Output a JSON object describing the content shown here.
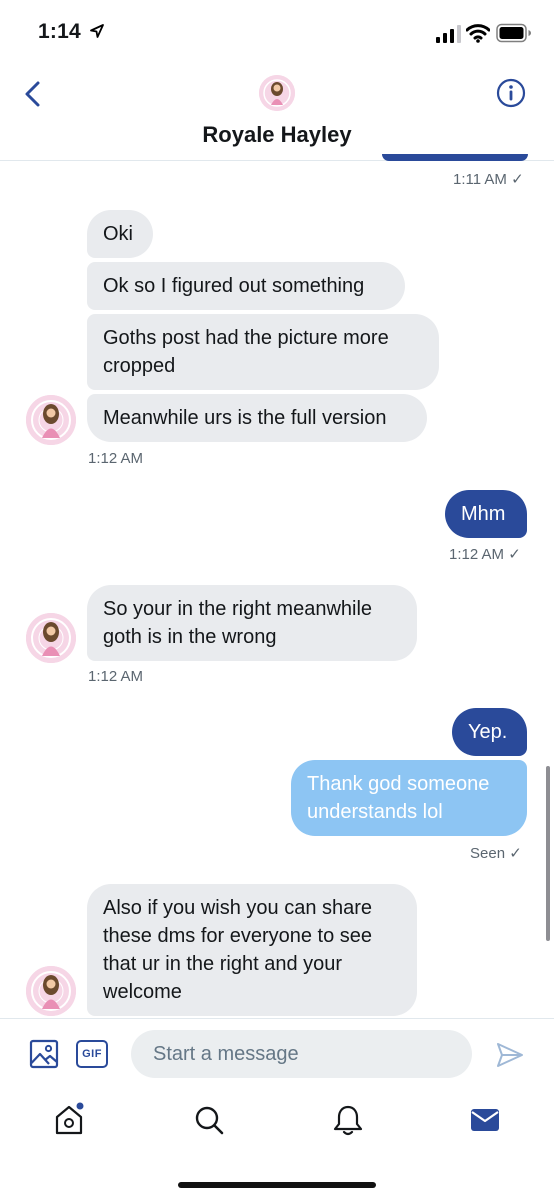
{
  "status_bar": {
    "time": "1:14"
  },
  "header": {
    "name": "Royale Hayley"
  },
  "messages": {
    "m0_meta": "1:11 AM ✓",
    "g1_b1": "Oki",
    "g1_b2": "Ok so I figured out something",
    "g1_b3_l1": "Goths post had the picture more",
    "g1_b3_l2": "cropped",
    "g1_b4": "Meanwhile urs is the full version",
    "g1_meta": "1:12 AM",
    "s1": "Mhm",
    "s1_meta": "1:12 AM ✓",
    "g2_l1": "So your in the right meanwhile",
    "g2_l2": "goth is in the wrong",
    "g2_meta": "1:12 AM",
    "s2": "Yep.",
    "s3_l1": "Thank god someone",
    "s3_l2": "understands lol",
    "seen": "Seen ✓",
    "g3_l1": "Also if you wish you can share",
    "g3_l2": "these dms for everyone to see",
    "g3_l3": "that ur in the right and your",
    "g3_l4": "welcome"
  },
  "composer": {
    "placeholder": "Start a message",
    "gif_label": "GIF"
  },
  "colors": {
    "accent": "#2a4a9a",
    "sent_light": "#8dc5f3",
    "received": "#e9ebee"
  },
  "icons": [
    "back-chevron-icon",
    "info-icon",
    "image-icon",
    "gif-icon",
    "send-icon",
    "home-icon",
    "search-icon",
    "notifications-bell-icon",
    "messages-mail-icon"
  ]
}
